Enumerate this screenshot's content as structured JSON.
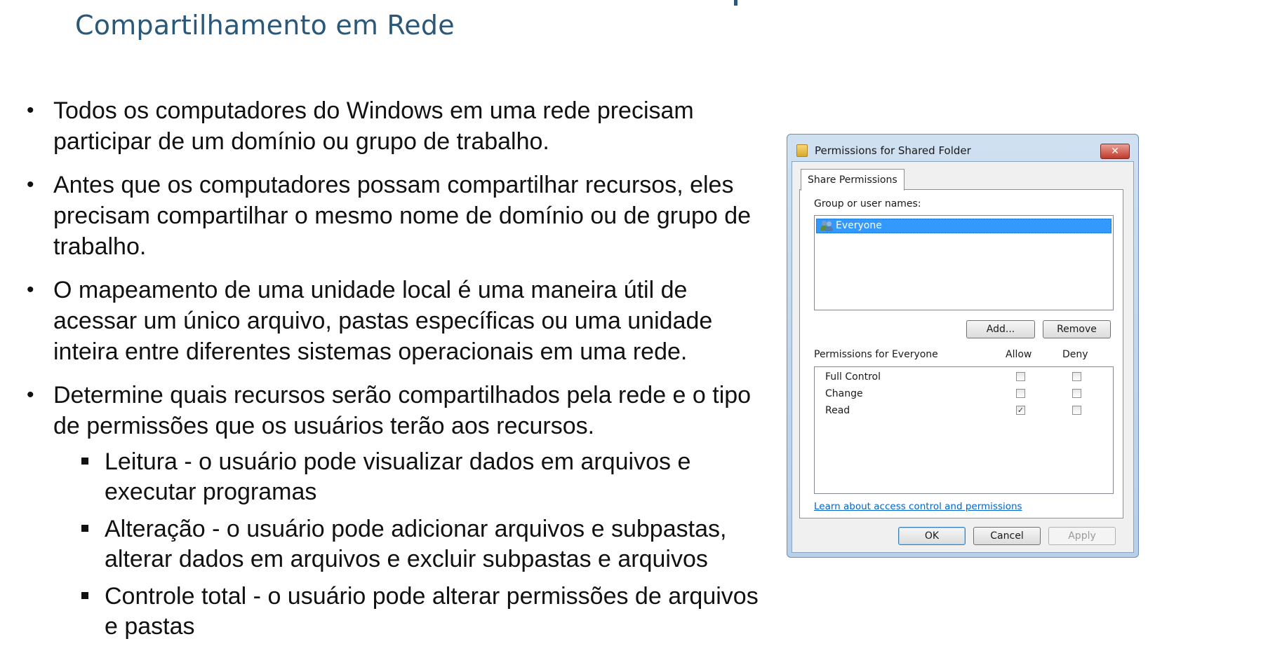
{
  "slide": {
    "title": "Compartilhamento em Rede",
    "bullets": [
      "Todos os computadores do Windows em uma rede precisam participar de um domínio ou grupo de trabalho.",
      "Antes que os computadores possam compartilhar recursos, eles precisam compartilhar o mesmo nome de domínio ou de grupo de trabalho.",
      "O mapeamento de uma unidade local é uma maneira útil de acessar um único arquivo, pastas específicas ou uma unidade inteira entre diferentes sistemas operacionais em uma rede.",
      "Determine quais recursos serão compartilhados pela rede e o tipo de permissões que os usuários terão aos recursos."
    ],
    "sub_bullets": [
      "Leitura - o usuário pode visualizar dados em arquivos e executar programas",
      "Alteração - o usuário pode adicionar arquivos e subpastas, alterar dados em arquivos e excluir subpastas e arquivos",
      "Controle total - o usuário pode alterar permissões de arquivos e pastas"
    ],
    "bullet_glyph": "•"
  },
  "dialog": {
    "title": "Permissions for Shared Folder",
    "close_glyph": "✕",
    "tab": "Share Permissions",
    "group_label": "Group or user names:",
    "users": [
      "Everyone"
    ],
    "add_label": "Add...",
    "remove_label": "Remove",
    "permissions_label": "Permissions for Everyone",
    "allow_label": "Allow",
    "deny_label": "Deny",
    "permissions": [
      {
        "name": "Full Control",
        "allow": false,
        "deny": false
      },
      {
        "name": "Change",
        "allow": false,
        "deny": false
      },
      {
        "name": "Read",
        "allow": true,
        "deny": false
      }
    ],
    "link_text": "Learn about access control and permissions",
    "ok_label": "OK",
    "cancel_label": "Cancel",
    "apply_label": "Apply",
    "check_glyph": "✓"
  },
  "colors": {
    "title": "#2b5878",
    "selection": "#3399ff",
    "link": "#0066cc"
  }
}
